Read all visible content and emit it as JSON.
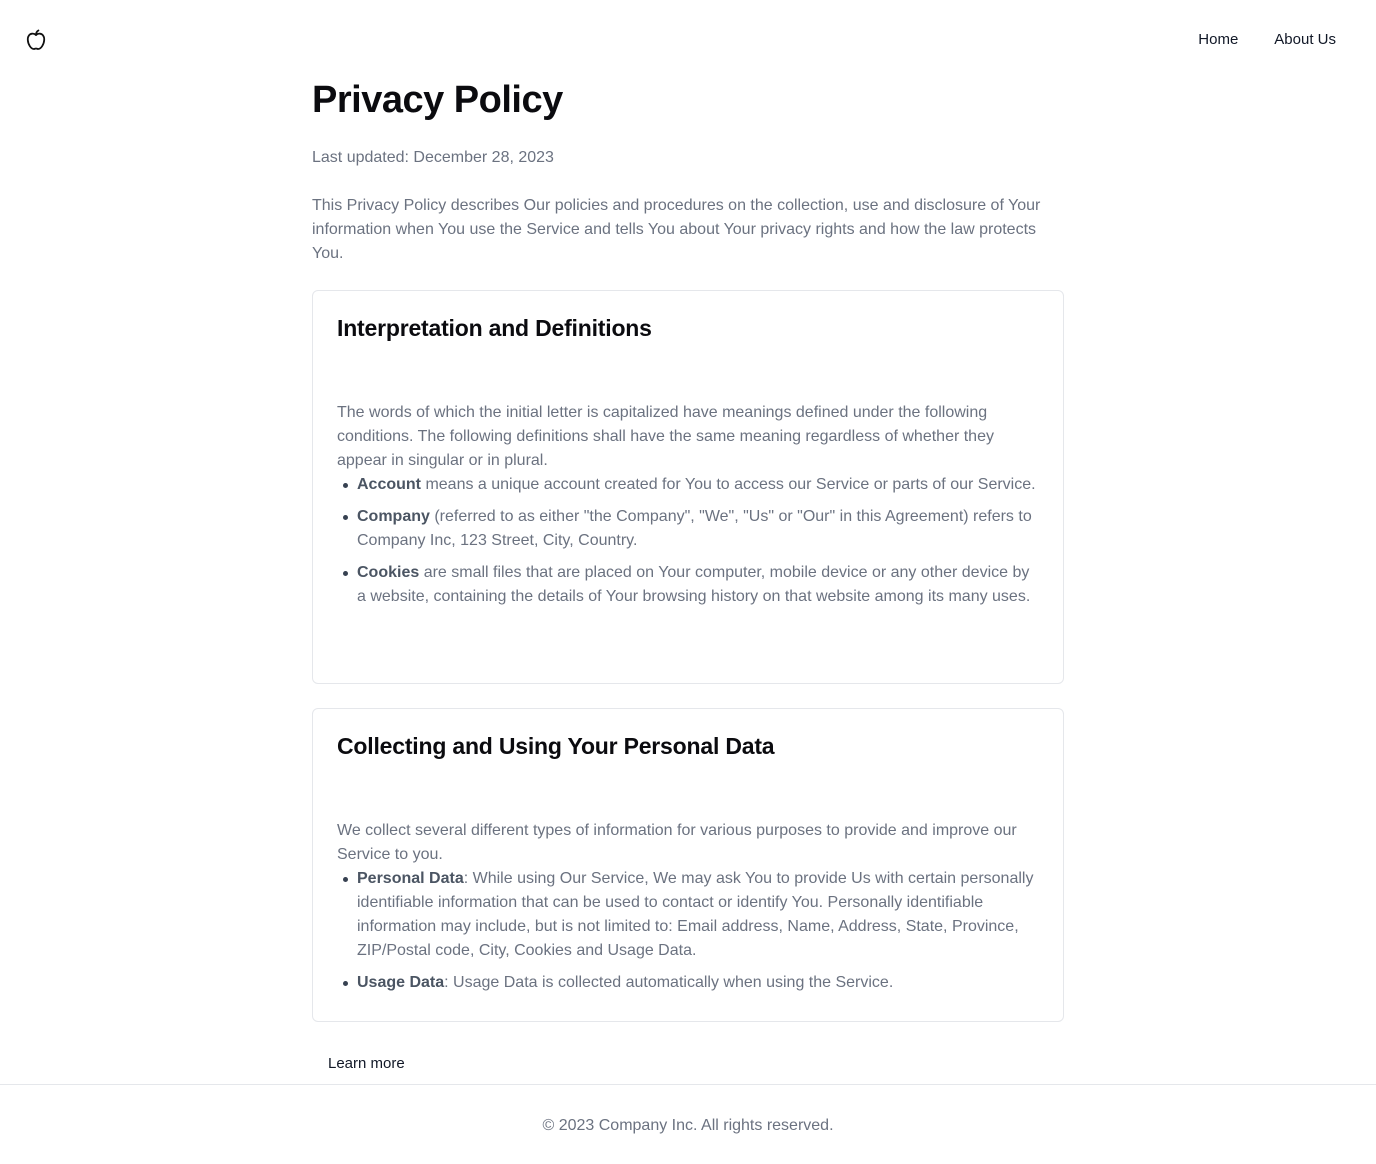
{
  "header": {
    "logo_icon": "apple-icon",
    "nav": {
      "home": "Home",
      "about": "About Us"
    }
  },
  "main": {
    "title": "Privacy Policy",
    "last_updated": "Last updated: December 28, 2023",
    "intro": "This Privacy Policy describes Our policies and procedures on the collection, use and disclosure of Your information when You use the Service and tells You about Your privacy rights and how the law protects You."
  },
  "sections": [
    {
      "heading": "Interpretation and Definitions",
      "body": "The words of which the initial letter is capitalized have meanings defined under the following conditions. The following definitions shall have the same meaning regardless of whether they appear in singular or in plural.",
      "items": [
        {
          "term": "Account",
          "text": " means a unique account created for You to access our Service or parts of our Service."
        },
        {
          "term": "Company",
          "text": " (referred to as either \"the Company\", \"We\", \"Us\" or \"Our\" in this Agreement) refers to Company Inc, 123 Street, City, Country."
        },
        {
          "term": "Cookies",
          "text": " are small files that are placed on Your computer, mobile device or any other device by a website, containing the details of Your browsing history on that website among its many uses."
        }
      ]
    },
    {
      "heading": "Collecting and Using Your Personal Data",
      "body": "We collect several different types of information for various purposes to provide and improve our Service to you.",
      "items": [
        {
          "term": "Personal Data",
          "text": ": While using Our Service, We may ask You to provide Us with certain personally identifiable information that can be used to contact or identify You. Personally identifiable information may include, but is not limited to: Email address, Name, Address, State, Province, ZIP/Postal code, City, Cookies and Usage Data."
        },
        {
          "term": "Usage Data",
          "text": ": Usage Data is collected automatically when using the Service."
        }
      ]
    }
  ],
  "learn_more": "Learn more",
  "footer": {
    "copyright": "© 2023 Company Inc. All rights reserved."
  }
}
